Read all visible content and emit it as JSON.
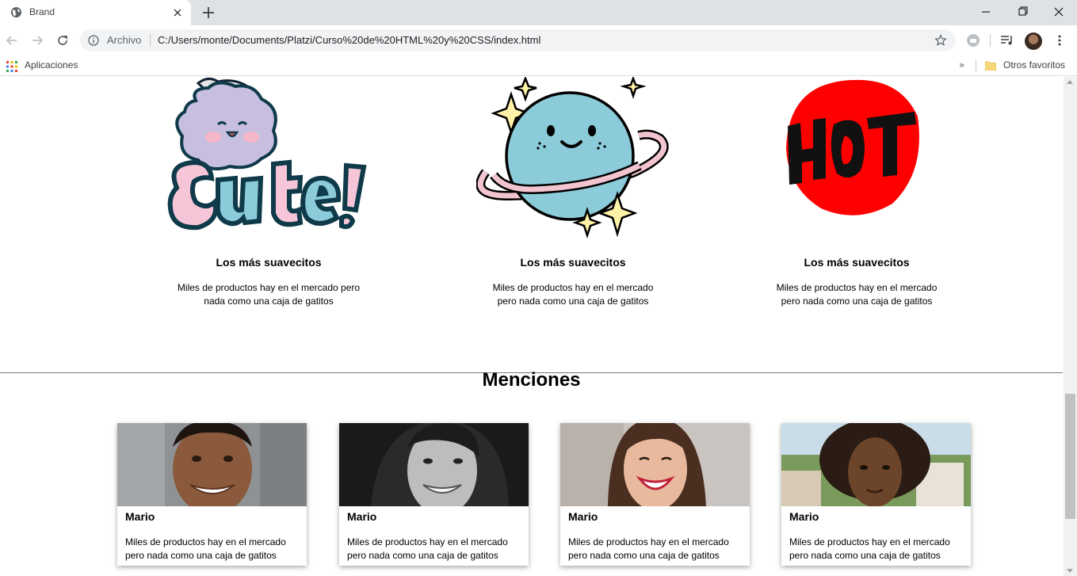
{
  "browser": {
    "tab_title": "Brand",
    "scheme_label": "Archivo",
    "url": "C:/Users/monte/Documents/Platzi/Curso%20de%20HTML%20y%20CSS/index.html",
    "bookmarks_apps": "Aplicaciones",
    "bookmarks_more": "»",
    "bookmarks_folder": "Otros favoritos"
  },
  "features": [
    {
      "icon": "cute-sticker",
      "title": "Los más suavecitos",
      "text": "Miles de productos hay en el mercado pero nada como una caja de gatitos"
    },
    {
      "icon": "planet-sticker",
      "title": "Los más suavecitos",
      "text": "Miles de productos hay en el mercado pero nada como una caja de gatitos"
    },
    {
      "icon": "hot-sticker",
      "title": "Los más suavecitos",
      "text": "Miles de productos hay en el mercado pero nada como una caja de gatitos"
    }
  ],
  "mentions": {
    "title": "Menciones",
    "cards": [
      {
        "photo": "smiling-man-photo",
        "name": "Mario",
        "text": "Miles de productos hay en el mercado pero nada como una caja de gatitos"
      },
      {
        "photo": "woman-bw-photo",
        "name": "Mario",
        "text": "Miles de productos hay en el mercado pero nada como una caja de gatitos"
      },
      {
        "photo": "laughing-woman-photo",
        "name": "Mario",
        "text": "Miles de productos hay en el mercado pero nada como una caja de gatitos"
      },
      {
        "photo": "curly-hair-woman-photo",
        "name": "Mario",
        "text": "Miles de productos hay en el mercado pero nada como una caja de gatitos"
      }
    ]
  },
  "colors": {
    "hot_red": "#ff0000",
    "planet_blue": "#8ccbd9",
    "ring_pink": "#f2c4cf",
    "cute_purple": "#c8bfe0"
  }
}
